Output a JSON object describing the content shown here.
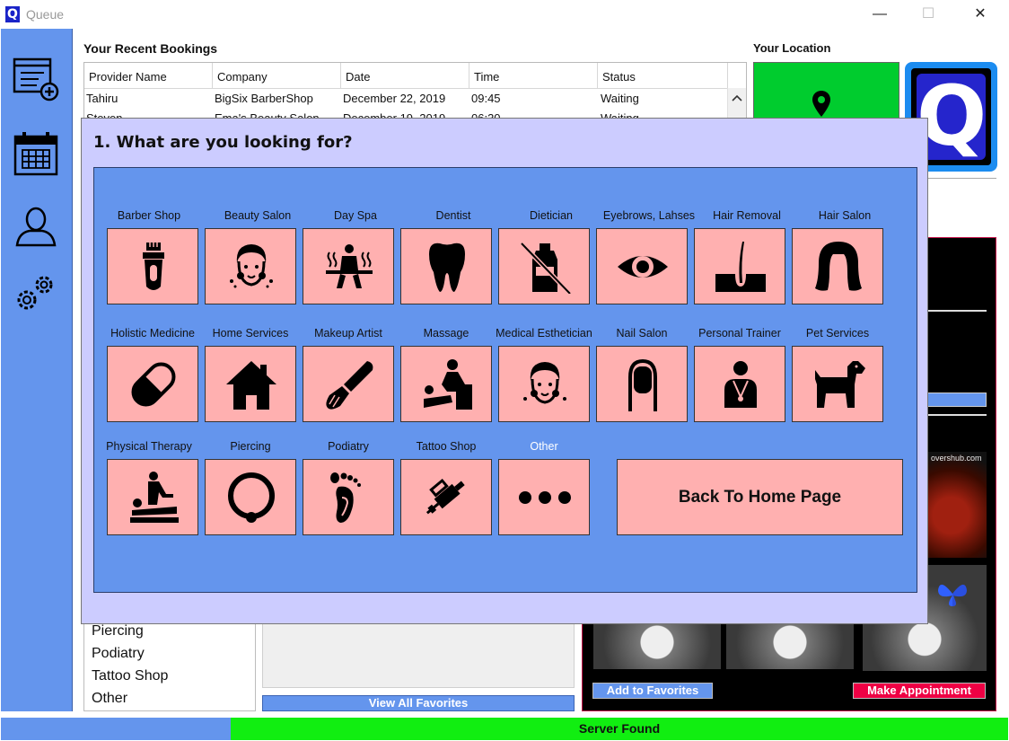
{
  "window": {
    "title": "Queue",
    "app_icon": "Q",
    "minimize": "—",
    "maximize": "☐",
    "close": "✕"
  },
  "sidebar": {
    "items": [
      {
        "name": "new-booking-icon"
      },
      {
        "name": "calendar-icon"
      },
      {
        "name": "profile-icon"
      },
      {
        "name": "settings-icon"
      }
    ]
  },
  "bookings": {
    "title": "Your Recent Bookings",
    "columns": [
      "Provider Name",
      "Company",
      "Date",
      "Time",
      "Status"
    ],
    "rows": [
      [
        "Tahiru",
        "BigSix BarberShop",
        "December 22, 2019",
        "09:45",
        "Waiting"
      ],
      [
        "Steven",
        "Ema's Beauty Salon",
        "December 19, 2019",
        "06:30",
        "Waiting"
      ]
    ]
  },
  "location": {
    "title": "Your Location",
    "color": "#00cc2e"
  },
  "logo": {
    "letter": "Q"
  },
  "right_panel": {
    "partial_url": "overshub.com"
  },
  "category_list": {
    "items": [
      "Piercing",
      "Podiatry",
      "Tattoo Shop",
      "Other"
    ]
  },
  "favorites": {
    "view_all": "View All Favorites",
    "add": "Add to Favorites",
    "make_appointment": "Make Appointment"
  },
  "status": {
    "text": "Server Found",
    "color": "#11ee11"
  },
  "modal": {
    "title": "1. What are you looking for?",
    "categories": [
      {
        "label": "Barber Shop",
        "icon": "clipper-icon"
      },
      {
        "label": "Beauty Salon",
        "icon": "face-mask-icon"
      },
      {
        "label": "Day Spa",
        "icon": "sauna-icon"
      },
      {
        "label": "Dentist",
        "icon": "tooth-icon"
      },
      {
        "label": "Dietician",
        "icon": "no-bottle-icon"
      },
      {
        "label": "Eyebrows, Lahses",
        "icon": "eye-icon"
      },
      {
        "label": "Hair Removal",
        "icon": "hair-follicle-icon"
      },
      {
        "label": "Hair Salon",
        "icon": "hair-icon"
      },
      {
        "label": "Holistic Medicine",
        "icon": "pill-icon"
      },
      {
        "label": "Home Services",
        "icon": "house-icon"
      },
      {
        "label": "Makeup Artist",
        "icon": "makeup-brush-icon"
      },
      {
        "label": "Massage",
        "icon": "massage-icon"
      },
      {
        "label": "Medical Esthetician",
        "icon": "face-mask-icon"
      },
      {
        "label": "Nail Salon",
        "icon": "nail-icon"
      },
      {
        "label": "Personal Trainer",
        "icon": "trainer-icon"
      },
      {
        "label": "Pet Services",
        "icon": "dog-icon"
      },
      {
        "label": "Physical Therapy",
        "icon": "therapy-icon"
      },
      {
        "label": "Piercing",
        "icon": "ring-icon"
      },
      {
        "label": "Podiatry",
        "icon": "foot-icon"
      },
      {
        "label": "Tattoo Shop",
        "icon": "tattoo-gun-icon"
      },
      {
        "label": "Other",
        "icon": "more-icon"
      }
    ],
    "home_button": "Back To Home Page"
  }
}
